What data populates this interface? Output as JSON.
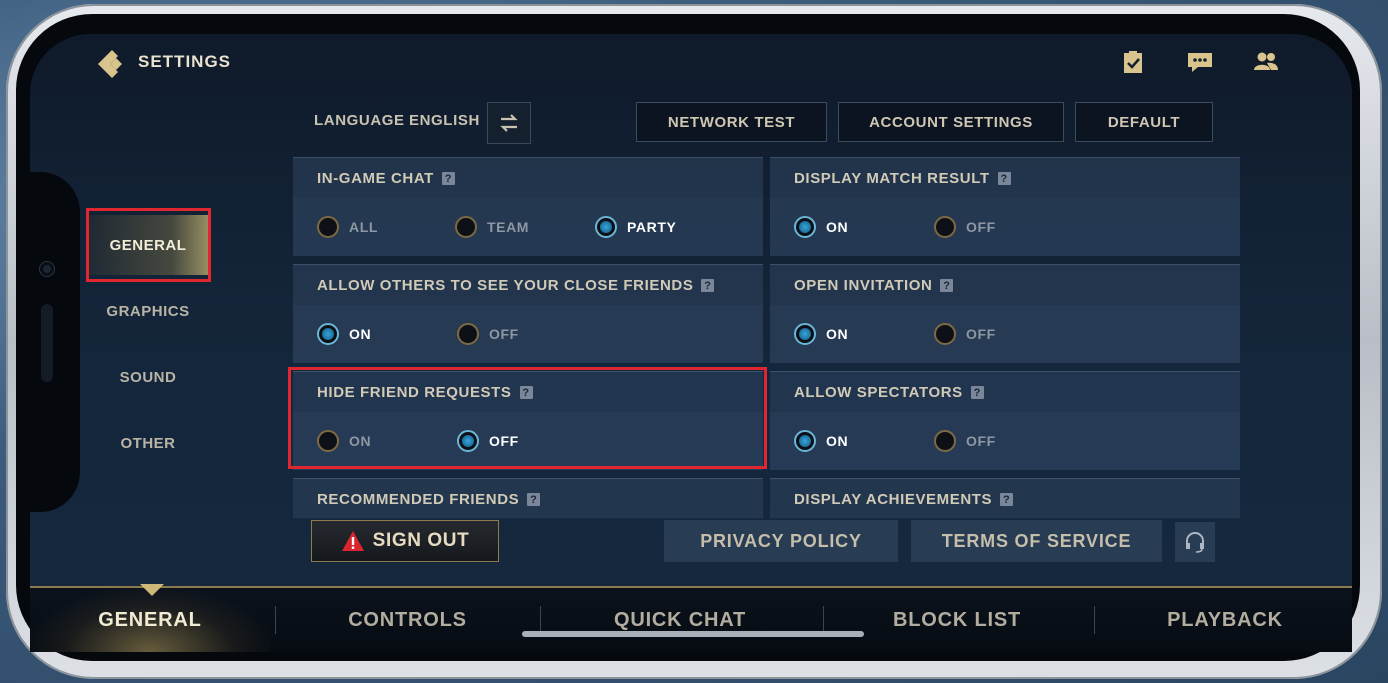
{
  "header": {
    "title": "SETTINGS"
  },
  "top_icons": [
    "clipboard-check-icon",
    "chat-icon",
    "friends-icon"
  ],
  "sidebar": {
    "items": [
      {
        "label": "GENERAL",
        "active": true
      },
      {
        "label": "GRAPHICS",
        "active": false
      },
      {
        "label": "SOUND",
        "active": false
      },
      {
        "label": "OTHER",
        "active": false
      }
    ]
  },
  "toolbar": {
    "language_label": "LANGUAGE",
    "language_value": "ENGLISH",
    "network_test": "NETWORK TEST",
    "account_settings": "ACCOUNT SETTINGS",
    "default": "DEFAULT"
  },
  "settings": {
    "in_game_chat": {
      "title": "IN-GAME CHAT",
      "options": [
        "ALL",
        "TEAM",
        "PARTY"
      ],
      "selected": "PARTY"
    },
    "display_match_result": {
      "title": "DISPLAY MATCH RESULT",
      "options": [
        "ON",
        "OFF"
      ],
      "selected": "ON"
    },
    "close_friends": {
      "title": "ALLOW OTHERS TO SEE YOUR CLOSE FRIENDS",
      "options": [
        "ON",
        "OFF"
      ],
      "selected": "ON"
    },
    "open_invitation": {
      "title": "OPEN INVITATION",
      "options": [
        "ON",
        "OFF"
      ],
      "selected": "ON"
    },
    "hide_friend_requests": {
      "title": "HIDE FRIEND REQUESTS",
      "options": [
        "ON",
        "OFF"
      ],
      "selected": "OFF"
    },
    "allow_spectators": {
      "title": "ALLOW SPECTATORS",
      "options": [
        "ON",
        "OFF"
      ],
      "selected": "ON"
    },
    "recommended_friends": {
      "title": "RECOMMENDED FRIENDS"
    },
    "display_achievements": {
      "title": "DISPLAY ACHIEVEMENTS"
    },
    "help_glyph": "?"
  },
  "footer": {
    "sign_out": "SIGN OUT",
    "privacy_policy": "PRIVACY POLICY",
    "terms_of_service": "TERMS OF SERVICE"
  },
  "tabs": [
    {
      "label": "GENERAL",
      "active": true
    },
    {
      "label": "CONTROLS",
      "active": false
    },
    {
      "label": "QUICK CHAT",
      "active": false
    },
    {
      "label": "BLOCK LIST",
      "active": false
    },
    {
      "label": "PLAYBACK",
      "active": false
    }
  ],
  "colors": {
    "accent_gold": "#c9b98f",
    "radio_on": "#38a4d6",
    "highlight_red": "#e0262e"
  }
}
